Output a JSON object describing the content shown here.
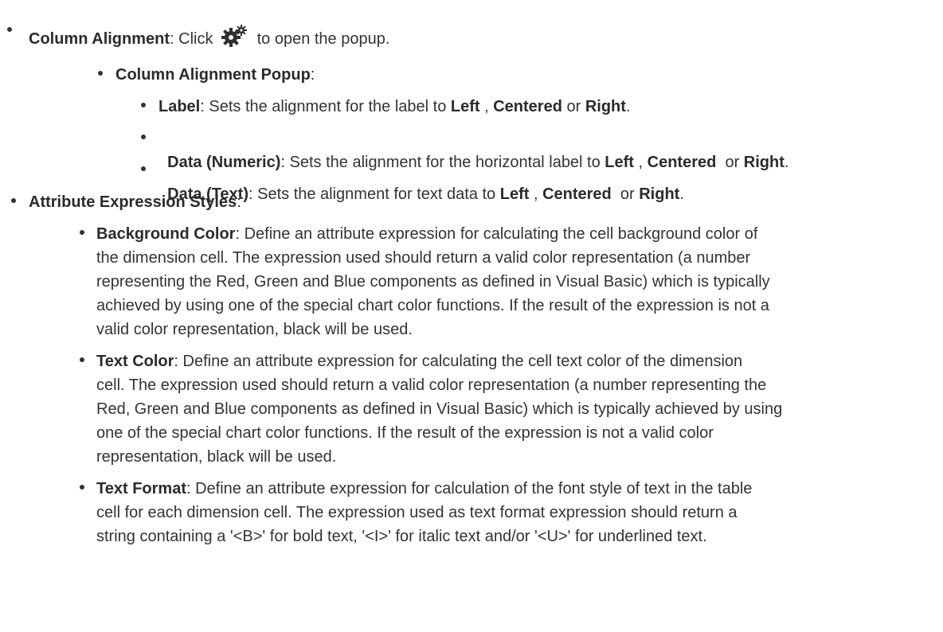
{
  "col_align": {
    "term": "Column Alignment",
    "pre": ": Click ",
    "post": " to open the popup.",
    "icon": "gear-settings-icon"
  },
  "popup": {
    "term": "Column Alignment Popup",
    "suffix": ":"
  },
  "label": {
    "term": "Label",
    "desc": ": Sets the alignment for the label to ",
    "o1": "Left",
    "sep1": " , ",
    "o2": "Centered",
    "sep2": " or ",
    "o3": "Right",
    "end": "."
  },
  "data_numeric": {
    "term": "Data (Numeric)",
    "desc": ": Sets the alignment for the horizontal label to ",
    "o1": "Left",
    "sep1": " , ",
    "o2": "Centered",
    "sep2": "  or ",
    "o3": "Right",
    "end": "."
  },
  "data_text": {
    "term": "Data (Text)",
    "desc": ": Sets the alignment for text data to ",
    "o1": "Left",
    "sep1": " , ",
    "o2": "Centered",
    "sep2": "  or ",
    "o3": "Right",
    "end": "."
  },
  "attr": {
    "term": "Attribute Expression Styles",
    "suffix": ":"
  },
  "bg": {
    "term": "Background Color",
    "l1": ": Define an attribute expression for calculating the cell background color of",
    "l2": "the dimension cell. The expression used should return a valid color representation (a number",
    "l3": "representing the Red, Green and Blue components as defined in Visual Basic) which is typically",
    "l4": "achieved by using one of the special chart color functions. If the result of the expression is not a",
    "l5": "valid color representation, black will be used."
  },
  "tc": {
    "term": "Text Color",
    "l1": ": Define an attribute expression for calculating the cell text color of the dimension",
    "l2": "cell. The expression used should return a valid color representation (a number representing the",
    "l3": "Red, Green and Blue components as defined in Visual Basic) which is typically achieved by using",
    "l4": "one of the special chart color functions. If the result of the expression is not a valid color",
    "l5": "representation, black will be used."
  },
  "tf": {
    "term": "Text Format",
    "l1": ": Define an attribute expression for calculation of the font style of text in the table",
    "l2": "cell for each dimension cell. The expression used as text format expression should return a",
    "l3": "string containing a '<B>' for bold text, '<I>' for italic text and/or '<U>' for underlined text."
  }
}
